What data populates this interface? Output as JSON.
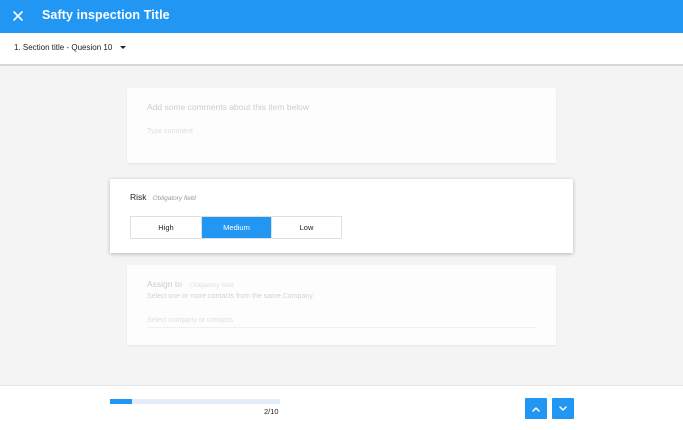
{
  "header": {
    "title": "Safty inspection Title",
    "close_icon": "close-icon",
    "background": "#2196f3"
  },
  "section": {
    "label": "1. Section title - Quesion 10",
    "dropdown_icon": "caret-down-icon"
  },
  "comments": {
    "heading": "Add some comments about this item below",
    "placeholder": "Type comment"
  },
  "risk": {
    "label": "Risk",
    "obligatory": "Obligatory field",
    "options": [
      "High",
      "Medium",
      "Low"
    ],
    "selected": "Medium"
  },
  "assign": {
    "label": "Assign to",
    "obligatory": "Obligatory field",
    "description": "Select one or more contacts from the same Company.",
    "placeholder": "Select company or contacts"
  },
  "footer": {
    "progress_current": 2,
    "progress_total": 10,
    "progress_text": "2/10",
    "prev_icon": "chevron-up-icon",
    "next_icon": "chevron-down-icon"
  },
  "colors": {
    "accent": "#2196f3",
    "background": "#f4f4f4"
  }
}
